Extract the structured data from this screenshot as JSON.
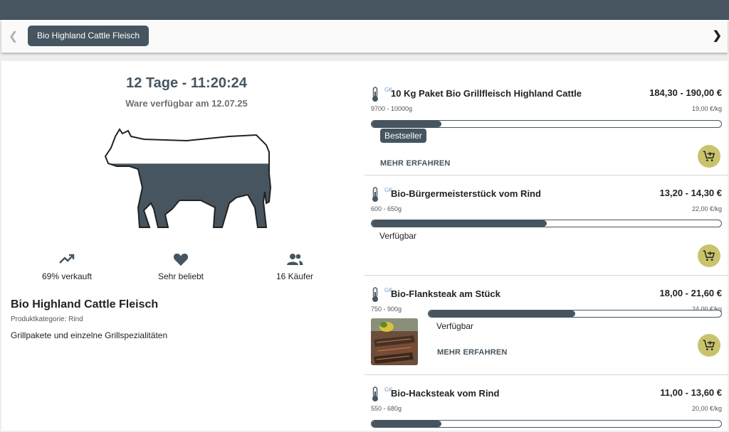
{
  "colors": {
    "accent": "#46555f",
    "cart": "#c9c46c"
  },
  "tabs": {
    "prev_icon": "chevron-left-icon",
    "active_label": "Bio Highland Cattle Fleisch",
    "next_icon": "chevron-right-icon"
  },
  "left": {
    "countdown": "12 Tage - 11:20:24",
    "available": "Ware verfügbar am 12.07.25",
    "stats": [
      {
        "icon": "trending-up-icon",
        "label": "69% verkauft"
      },
      {
        "icon": "heart-icon",
        "label": "Sehr beliebt"
      },
      {
        "icon": "people-icon",
        "label": "16 Käufer"
      }
    ],
    "product_title": "Bio Highland Cattle Fleisch",
    "product_category": "Produktkategorie: Rind",
    "product_description": "Grillpakete und einzelne Grillspezialitäten",
    "sold_fraction": 0.69
  },
  "items": [
    {
      "gk": "GK",
      "name": "10 Kg Paket Bio Grillfleisch Highland Cattle",
      "price": "184,30 - 190,00 €",
      "weight": "9700 - 10000g",
      "per_kg": "19,00 €/kg",
      "sold_fraction": 0.2,
      "badge": "Bestseller",
      "more": "MEHR ERFAHREN"
    },
    {
      "gk": "GK",
      "name": "Bio-Bürgermeisterstück vom Rind",
      "price": "13,20 - 14,30 €",
      "weight": "600 - 650g",
      "per_kg": "22,00 €/kg",
      "sold_fraction": 0.5,
      "status": "Verfügbar"
    },
    {
      "gk": "GK",
      "name": "Bio-Flanksteak am Stück",
      "price": "18,00 - 21,60 €",
      "weight": "750 - 900g",
      "per_kg": "24,00 €/kg",
      "sold_fraction": 0.5,
      "status": "Verfügbar",
      "more": "MEHR ERFAHREN"
    },
    {
      "gk": "GK",
      "name": "Bio-Hacksteak vom Rind",
      "price": "11,00 - 13,60 €",
      "weight": "550 - 680g",
      "per_kg": "20,00 €/kg",
      "sold_fraction": 0.2
    }
  ]
}
